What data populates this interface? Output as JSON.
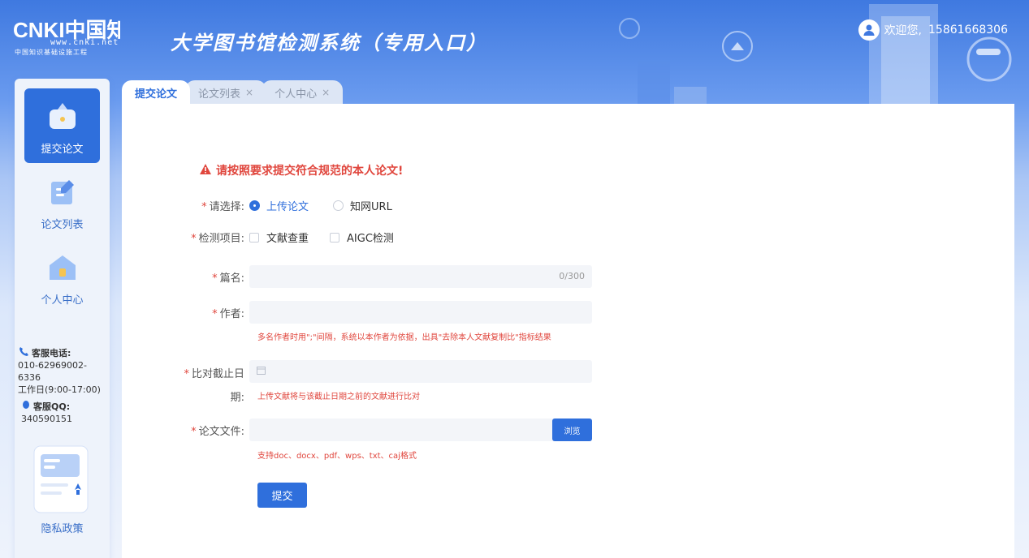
{
  "header": {
    "logo_text": "CNKI中国知网",
    "logo_url": "www.cnki.net",
    "logo_sub": "中国知识基础设施工程",
    "title": "大学图书馆检测系统（专用入口）",
    "greeting": "欢迎您,",
    "user_id": "15861668306"
  },
  "sidebar": {
    "items": [
      {
        "label": "提交论文",
        "icon": "upload-box-icon",
        "active": true
      },
      {
        "label": "论文列表",
        "icon": "document-list-icon",
        "active": false
      },
      {
        "label": "个人中心",
        "icon": "house-icon",
        "active": false
      }
    ],
    "contact": {
      "phone_title": "客服电话:",
      "phone_number": "010-62969002-6336",
      "phone_number_line1": "010-62969002-",
      "phone_number_line2": "6336",
      "hours": "工作日(9:00-17:00)",
      "qq_title": "客服QQ:",
      "qq_number": "340590151"
    },
    "privacy_label": "隐私政策"
  },
  "tabs": [
    {
      "label": "提交论文",
      "active": true,
      "closable": false
    },
    {
      "label": "论文列表",
      "active": false,
      "closable": true
    },
    {
      "label": "个人中心",
      "active": false,
      "closable": true
    }
  ],
  "tab_close_glyph": "×",
  "form": {
    "warning": "请按照要求提交符合规范的本人论文!",
    "required_mark": "*",
    "choose_label": "请选择:",
    "choose_options": [
      {
        "label": "上传论文",
        "checked": true
      },
      {
        "label": "知网URL",
        "checked": false
      }
    ],
    "check_label": "检测项目:",
    "check_options": [
      {
        "label": "文献查重",
        "checked": false
      },
      {
        "label": "AIGC检测",
        "checked": false
      }
    ],
    "title_label": "篇名:",
    "title_value": "",
    "title_counter": "0/300",
    "author_label": "作者:",
    "author_value": "",
    "author_hint": "多名作者时用\";\"间隔，系统以本作者为依据，出具\"去除本人文献复制比\"指标结果",
    "date_label_line1": "比对截止日",
    "date_label_line2": "期:",
    "date_value": "",
    "date_hint": "上传文献将与该截止日期之前的文献进行比对",
    "file_label": "论文文件:",
    "file_value": "",
    "browse_label": "浏览",
    "file_hint": "支持doc、docx、pdf、wps、txt、caj格式",
    "submit_label": "提交"
  },
  "colors": {
    "accent": "#2f6fdc",
    "warning": "#e0463d",
    "sidebar_bg": "#eef3fb"
  }
}
